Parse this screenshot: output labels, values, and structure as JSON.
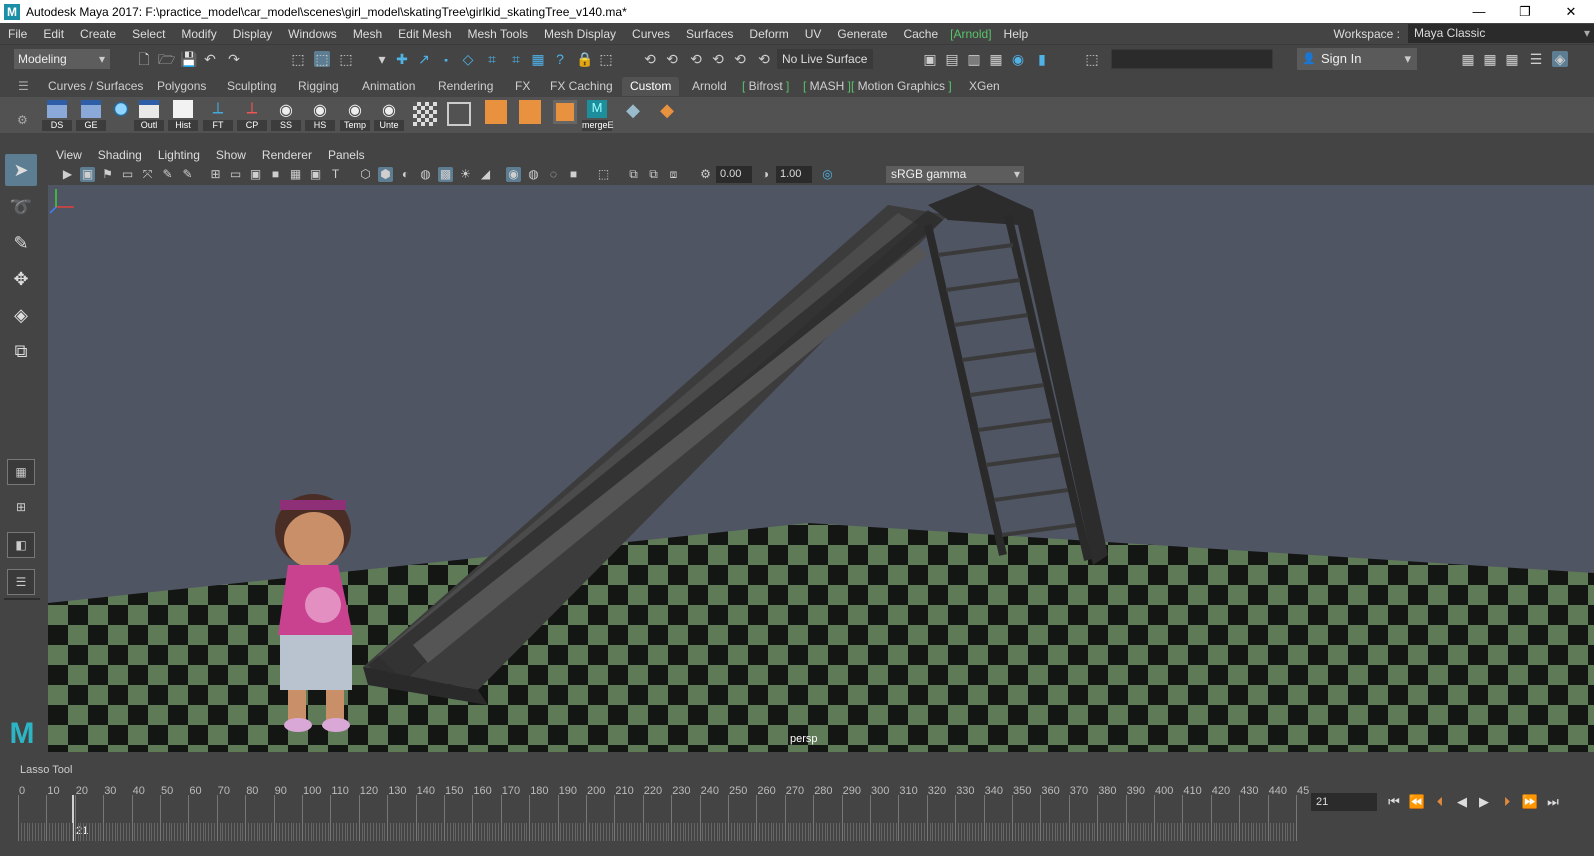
{
  "window": {
    "title": "Autodesk Maya 2017: F:\\practice_model\\car_model\\scenes\\girl_model\\skatingTree\\girlkid_skatingTree_v140.ma*",
    "minimize_icon": "minimize-icon",
    "restore_icon": "restore-icon",
    "close_icon": "close-icon"
  },
  "menubar": {
    "items": [
      "File",
      "Edit",
      "Create",
      "Select",
      "Modify",
      "Display",
      "Windows",
      "Mesh",
      "Edit Mesh",
      "Mesh Tools",
      "Mesh Display",
      "Curves",
      "Surfaces",
      "Deform",
      "UV",
      "Generate",
      "Cache",
      "Arnold",
      "Help"
    ],
    "arnold_label": "Arnold",
    "workspace_label": "Workspace :",
    "workspace_value": "Maya Classic"
  },
  "statusline": {
    "mode": "Modeling",
    "live_surface": "No Live Surface",
    "sign_in": "Sign In"
  },
  "shelf": {
    "tabs": [
      "Curves / Surfaces",
      "Polygons",
      "Sculpting",
      "Rigging",
      "Animation",
      "Rendering",
      "FX",
      "FX Caching",
      "Custom",
      "Arnold",
      "Bifrost",
      "MASH",
      "Motion Graphics",
      "XGen"
    ],
    "active_tab": "Custom",
    "buttons": [
      "DS",
      "GE",
      "",
      "Outl",
      "Hist",
      "FT",
      "CP",
      "SS",
      "HS",
      "Temp",
      "Unte",
      "",
      "",
      "",
      "",
      "",
      "mergeE",
      "",
      ""
    ]
  },
  "panel": {
    "menus": [
      "View",
      "Shading",
      "Lighting",
      "Show",
      "Renderer",
      "Panels"
    ],
    "exposure": "0.00",
    "gamma": "1.00",
    "color_space": "sRGB gamma",
    "camera": "persp"
  },
  "help_line": "Lasso Tool",
  "timeline": {
    "ticks": [
      "0",
      "10",
      "20",
      "30",
      "40",
      "50",
      "60",
      "70",
      "80",
      "90",
      "100",
      "110",
      "120",
      "130",
      "140",
      "150",
      "160",
      "170",
      "180",
      "190",
      "200",
      "210",
      "220",
      "230",
      "240",
      "250",
      "260",
      "270",
      "280",
      "290",
      "300",
      "310",
      "320",
      "330",
      "340",
      "350",
      "360",
      "370",
      "380",
      "390",
      "400",
      "410",
      "420",
      "430",
      "440",
      "45"
    ],
    "current_frame": "21",
    "frame_field": "21"
  },
  "colors": {
    "accent": "#5d7e92",
    "arnold_green": "#59c36a",
    "viewport_bg": "#4f5562",
    "checker_green": "#5f7a57",
    "maya_teal": "#2cb5c4"
  }
}
